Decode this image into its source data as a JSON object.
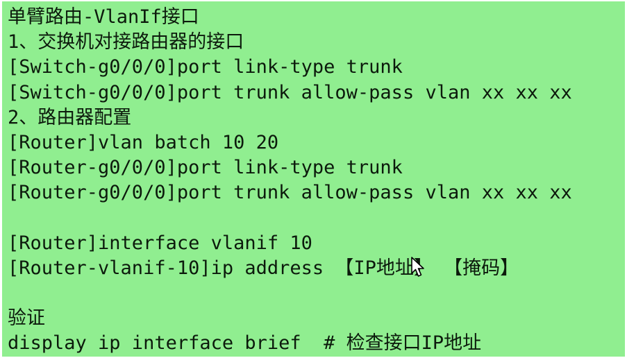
{
  "colors": {
    "background": "#90ee90",
    "text": "#0c1a0c"
  },
  "lines": [
    "单臂路由-VlanIf接口",
    "1、交换机对接路由器的接口",
    "[Switch-g0/0/0]port link-type trunk",
    "[Switch-g0/0/0]port trunk allow-pass vlan xx xx xx",
    "2、路由器配置",
    "[Router]vlan batch 10 20",
    "[Router-g0/0/0]port link-type trunk",
    "[Router-g0/0/0]port trunk allow-pass vlan xx xx xx",
    "",
    "[Router]interface vlanif 10",
    "[Router-vlanif-10]ip address 【IP地址】 【掩码】",
    "",
    "验证",
    "display ip interface brief  # 检查接口IP地址"
  ],
  "cursor_icon": "mouse-pointer-icon"
}
